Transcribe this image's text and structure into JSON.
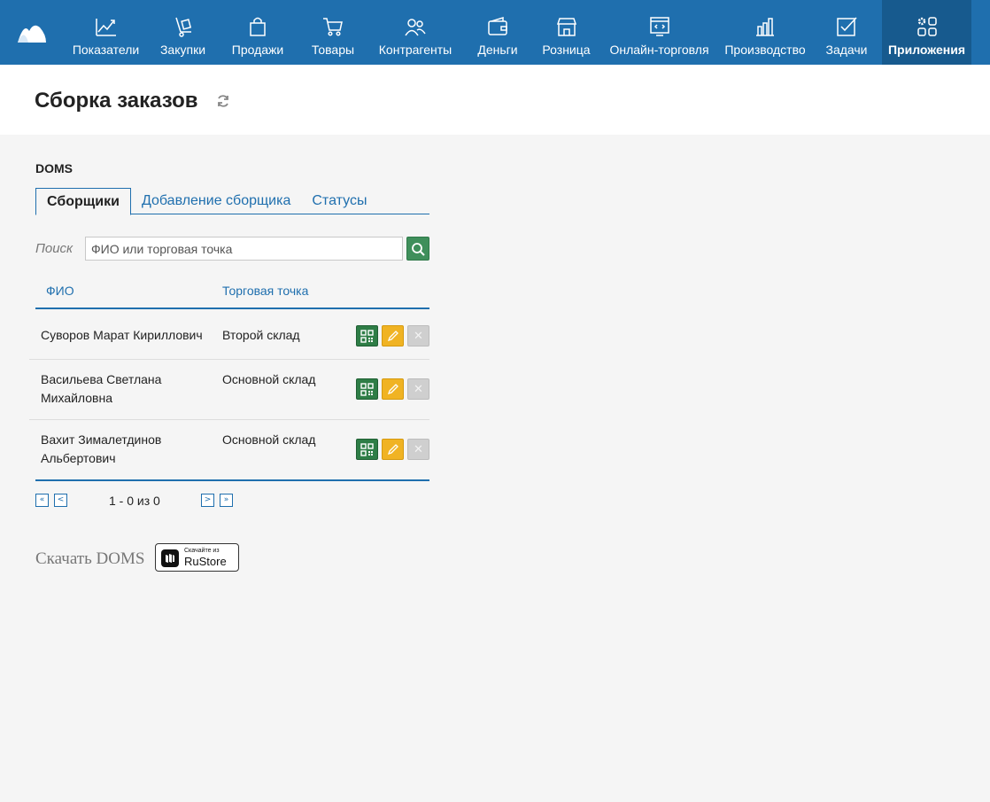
{
  "nav": {
    "items": [
      {
        "label": "Показатели",
        "icon": "chart-line-icon"
      },
      {
        "label": "Закупки",
        "icon": "hand-truck-icon"
      },
      {
        "label": "Продажи",
        "icon": "shopping-bag-icon"
      },
      {
        "label": "Товары",
        "icon": "cart-icon"
      },
      {
        "label": "Контрагенты",
        "icon": "people-icon"
      },
      {
        "label": "Деньги",
        "icon": "wallet-icon"
      },
      {
        "label": "Розница",
        "icon": "storefront-icon"
      },
      {
        "label": "Онлайн-торговля",
        "icon": "online-store-icon"
      },
      {
        "label": "Производство",
        "icon": "factory-icon"
      },
      {
        "label": "Задачи",
        "icon": "checkbox-icon"
      },
      {
        "label": "Приложения",
        "icon": "apps-gear-icon",
        "active": true
      }
    ],
    "accent": "#1f6fae"
  },
  "header": {
    "title": "Сборка заказов"
  },
  "app": {
    "name": "DOMS"
  },
  "tabs": [
    {
      "label": "Сборщики",
      "active": true
    },
    {
      "label": "Добавление сборщика"
    },
    {
      "label": "Статусы"
    }
  ],
  "search": {
    "label": "Поиск",
    "placeholder": "ФИО или торговая точка"
  },
  "table": {
    "columns": [
      "ФИО",
      "Торговая точка"
    ],
    "rows": [
      {
        "name": "Суворов Марат Кириллович",
        "store": "Второй склад"
      },
      {
        "name": "Васильева Светлана Михайловна",
        "store": "Основной склад"
      },
      {
        "name": "Вахит Зималетдинов Альбертович",
        "store": "Основной склад"
      }
    ]
  },
  "pager": {
    "first": "«",
    "prev": "<",
    "info": "1 - 0 из 0",
    "next": ">",
    "last": "»"
  },
  "download": {
    "label": "Скачать DOMS",
    "badge_small": "Скачайте из",
    "badge_big": "RuStore"
  },
  "colors": {
    "qr": "#2e7d46",
    "edit": "#f0b323",
    "delete": "#cfcfcf",
    "search_btn": "#3f8f5b"
  }
}
